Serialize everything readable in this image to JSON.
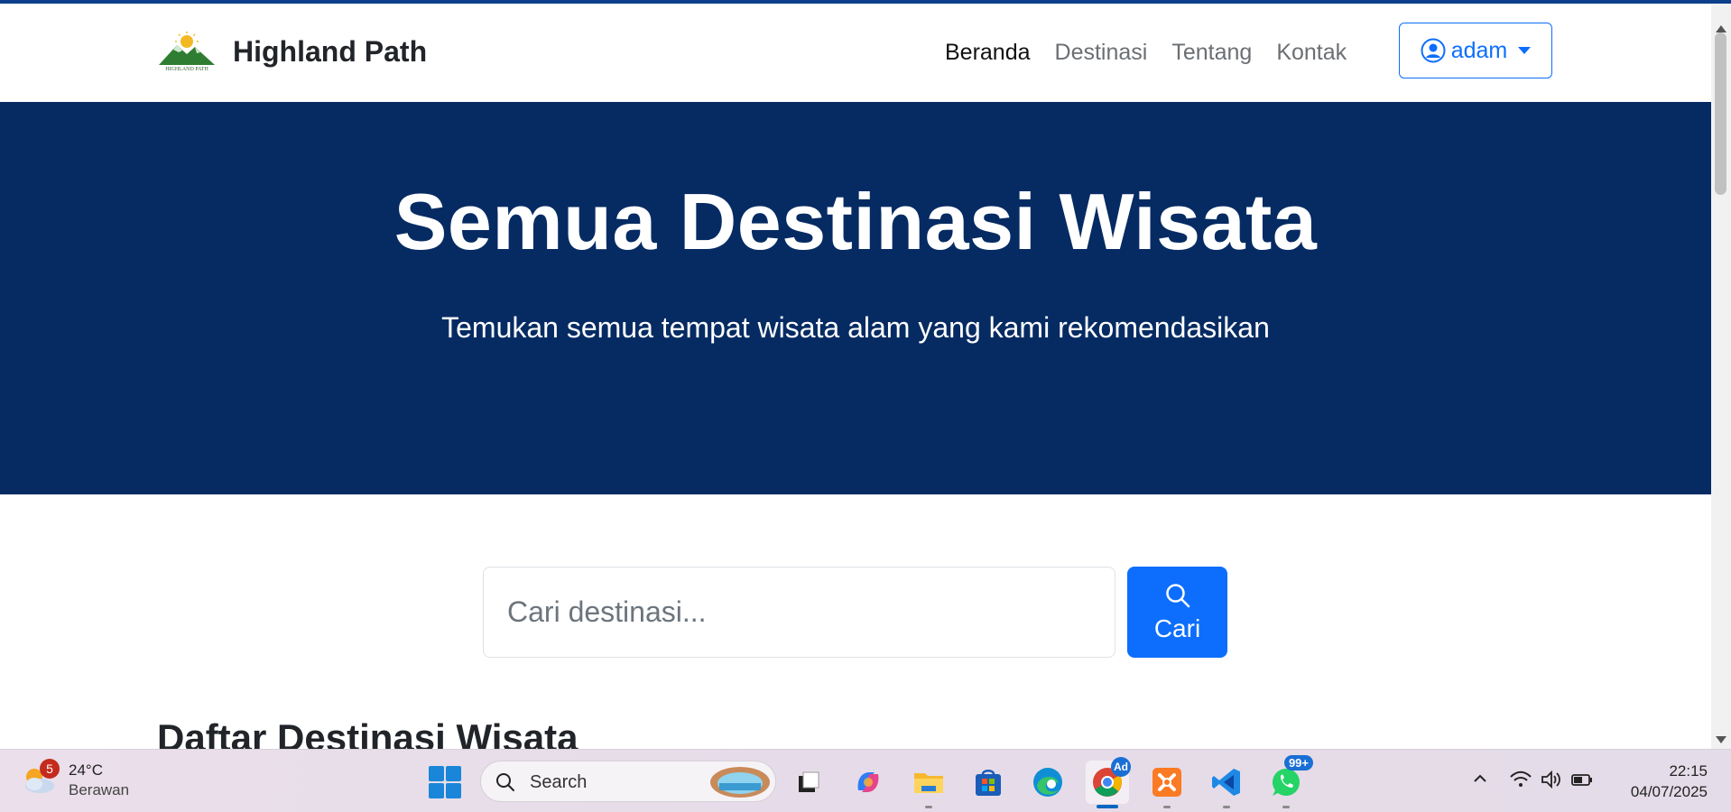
{
  "navbar": {
    "brand_name": "Highland Path",
    "logo_text": "HIGHLAND PATH",
    "links": [
      {
        "label": "Beranda",
        "active": true
      },
      {
        "label": "Destinasi",
        "active": false
      },
      {
        "label": "Tentang",
        "active": false
      },
      {
        "label": "Kontak",
        "active": false
      }
    ],
    "user": {
      "name": "adam",
      "icon": "user-circle-icon"
    }
  },
  "hero": {
    "title": "Semua Destinasi Wisata",
    "subtitle": "Temukan semua tempat wisata alam yang kami rekomendasikan",
    "background": "#062b63"
  },
  "search": {
    "placeholder": "Cari destinasi...",
    "value": "",
    "button_label": "Cari",
    "button_icon": "search-icon",
    "accent": "#0d6efd"
  },
  "section": {
    "title": "Daftar Destinasi Wisata"
  },
  "taskbar": {
    "weather": {
      "temp": "24°C",
      "desc": "Berawan",
      "badge": "5"
    },
    "search_label": "Search",
    "apps": [
      {
        "name": "task-view-icon"
      },
      {
        "name": "copilot-icon"
      },
      {
        "name": "file-explorer-icon"
      },
      {
        "name": "microsoft-store-icon"
      },
      {
        "name": "edge-icon"
      },
      {
        "name": "chrome-icon",
        "badge": "Ad"
      },
      {
        "name": "xampp-icon"
      },
      {
        "name": "vscode-icon"
      },
      {
        "name": "whatsapp-icon",
        "badge": "99+"
      }
    ],
    "clock": {
      "time": "22:15",
      "date": "04/07/2025"
    }
  }
}
